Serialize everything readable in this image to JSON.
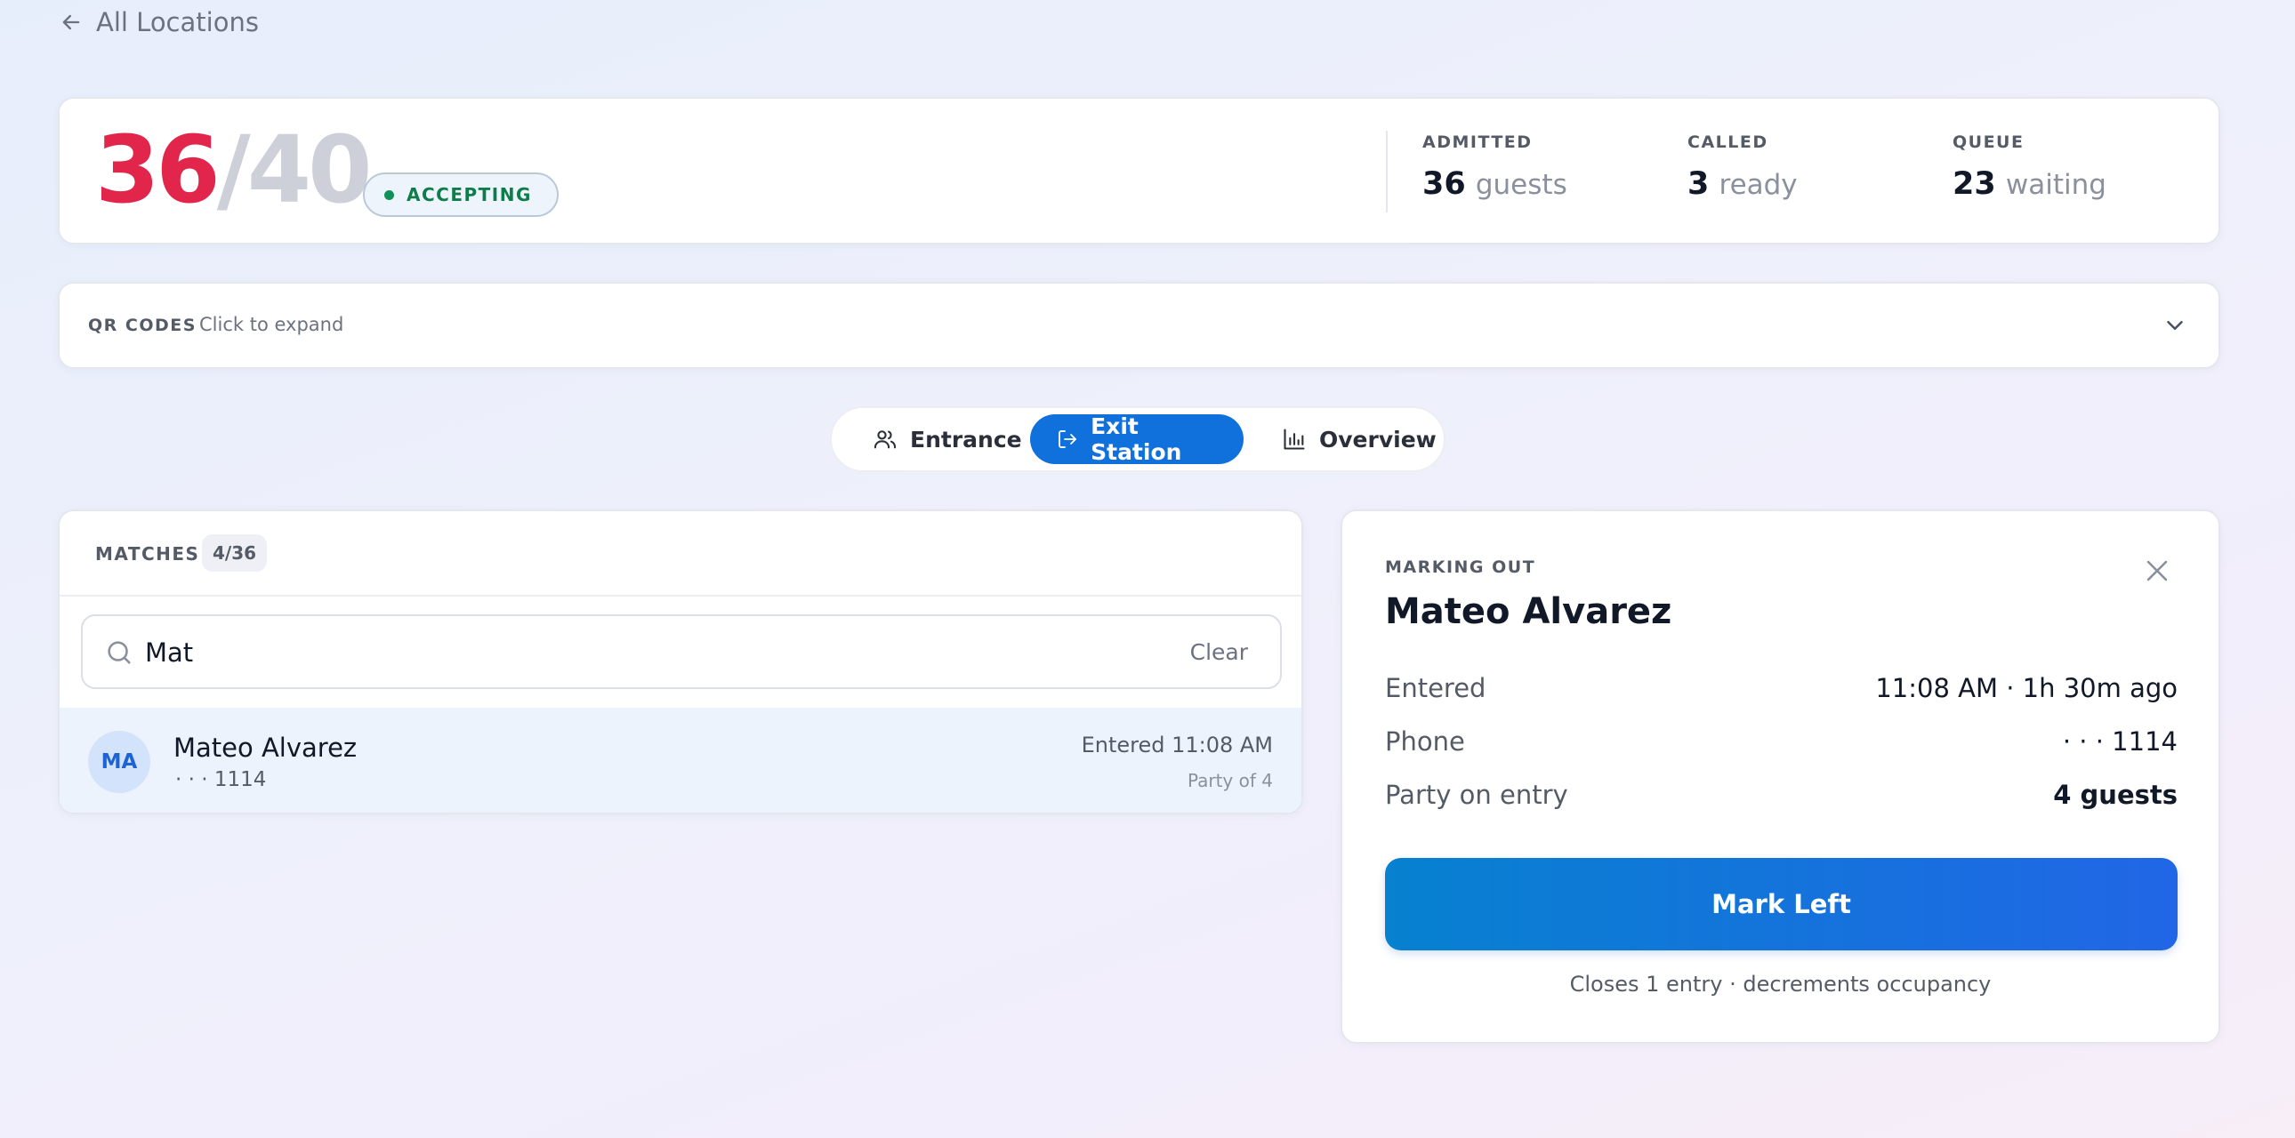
{
  "nav": {
    "back_label": "All Locations"
  },
  "occupancy": {
    "current": "36",
    "separator": "/",
    "capacity": "40",
    "status": "ACCEPTING",
    "stats": [
      {
        "label": "ADMITTED",
        "value": "36",
        "unit": "guests"
      },
      {
        "label": "CALLED",
        "value": "3",
        "unit": "ready"
      },
      {
        "label": "QUEUE",
        "value": "23",
        "unit": "waiting"
      }
    ]
  },
  "qr": {
    "label": "QR CODES",
    "hint": "Click to expand"
  },
  "tabs": [
    {
      "label": "Entrance",
      "icon": "users-icon",
      "active": false
    },
    {
      "label": "Exit Station",
      "icon": "exit-icon",
      "active": true
    },
    {
      "label": "Overview",
      "icon": "bar-chart-icon",
      "active": false
    }
  ],
  "matches": {
    "title": "MATCHES",
    "count": "4/36",
    "search_value": "Mat",
    "clear_label": "Clear",
    "results": [
      {
        "initials": "MA",
        "name": "Mateo Alvarez",
        "phone": "· · ·  1114",
        "entered": "Entered 11:08 AM",
        "party": "Party of 4"
      }
    ]
  },
  "marking": {
    "label": "MARKING OUT",
    "name": "Mateo Alvarez",
    "fields": [
      {
        "key": "Entered",
        "value": "11:08 AM · 1h 30m ago"
      },
      {
        "key": "Phone",
        "value": "· · ·   1114"
      },
      {
        "key": "Party on entry",
        "value": "4 guests"
      }
    ],
    "button_label": "Mark Left",
    "footnote": "Closes 1 entry · decrements occupancy"
  },
  "colors": {
    "accent": "#1070dc",
    "occupancy_current": "#e2264b",
    "status_green": "#0f7d4b"
  }
}
